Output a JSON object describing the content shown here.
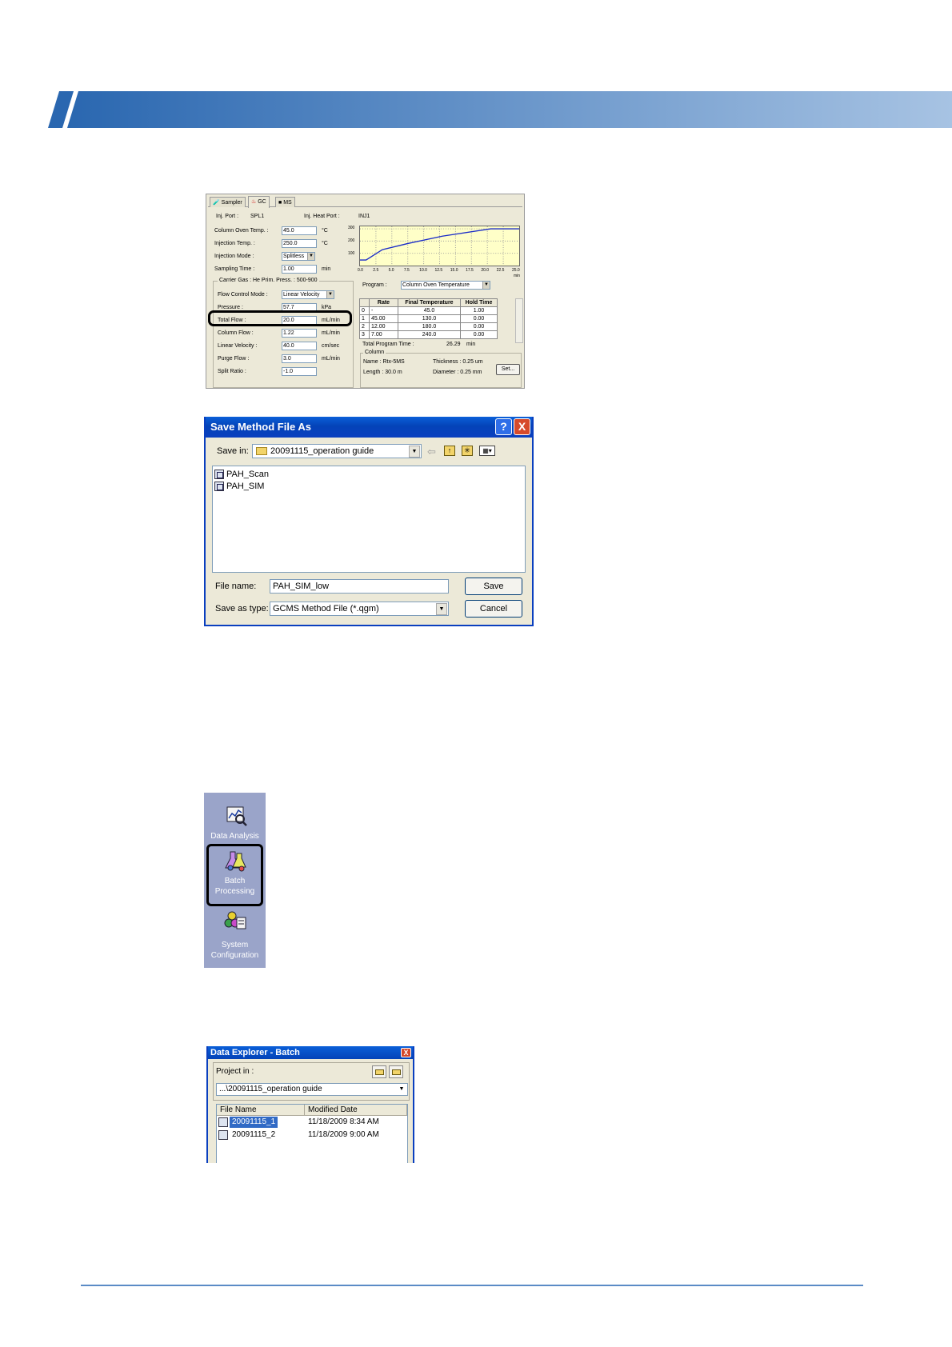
{
  "colors": {
    "banner_dark": "#2a67b0",
    "banner_light": "#a7c3e3",
    "xp_title": "#0a3fbf",
    "sidebar_bg": "#9aa4c9",
    "footer_line": "#5b8bc6"
  },
  "gc_panel": {
    "tabs": [
      {
        "label": "Sampler",
        "icon": "sampler-icon"
      },
      {
        "label": "GC",
        "icon": "gc-icon"
      },
      {
        "label": "MS",
        "icon": "ms-icon"
      }
    ],
    "inj_port_label": "Inj. Port :",
    "inj_port_value": "SPL1",
    "inj_heat_port_label": "Inj. Heat Port :",
    "inj_heat_port_value": "INJ1",
    "column_oven_temp": {
      "label": "Column Oven Temp. :",
      "value": "45.0",
      "unit": "°C"
    },
    "injection_temp": {
      "label": "Injection Temp. :",
      "value": "250.0",
      "unit": "°C"
    },
    "injection_mode": {
      "label": "Injection Mode :",
      "value": "Splitless"
    },
    "sampling_time": {
      "label": "Sampling Time :",
      "value": "1.00",
      "unit": "min"
    },
    "carrier_gas": "Carrier Gas : He    Prim. Press. : 500-900",
    "flow_control_mode": {
      "label": "Flow Control Mode :",
      "value": "Linear Velocity"
    },
    "pressure": {
      "label": "Pressure :",
      "value": "57.7",
      "unit": "kPa"
    },
    "total_flow": {
      "label": "Total Flow :",
      "value": "20.0",
      "unit": "mL/min"
    },
    "column_flow": {
      "label": "Column Flow :",
      "value": "1.22",
      "unit": "mL/min"
    },
    "linear_velocity": {
      "label": "Linear Velocity :",
      "value": "40.0",
      "unit": "cm/sec"
    },
    "purge_flow": {
      "label": "Purge Flow :",
      "value": "3.0",
      "unit": "mL/min"
    },
    "split_ratio": {
      "label": "Split Ratio :",
      "value": "-1.0"
    },
    "chart_x_ticks": [
      "0.0",
      "2.5",
      "5.0",
      "7.5",
      "10.0",
      "12.5",
      "15.0",
      "17.5",
      "20.0",
      "22.5",
      "25.0"
    ],
    "chart_x_unit": "min",
    "chart_y_ticks": [
      "300",
      "200",
      "100"
    ],
    "chart_profile": [
      [
        0,
        45
      ],
      [
        1,
        45
      ],
      [
        3.7,
        130
      ],
      [
        3.7,
        130
      ],
      [
        7.9,
        180
      ],
      [
        13.6,
        240
      ],
      [
        21.6,
        300
      ],
      [
        26.3,
        300
      ]
    ],
    "program_label": "Program :",
    "program_value": "Column Oven Temperature",
    "table_headers": [
      "",
      "Rate",
      "Final Temperature",
      "Hold Time"
    ],
    "table_rows": [
      [
        "0",
        "-",
        "45.0",
        "1.00"
      ],
      [
        "1",
        "45.00",
        "130.0",
        "0.00"
      ],
      [
        "2",
        "12.00",
        "180.0",
        "0.00"
      ],
      [
        "3",
        "7.00",
        "240.0",
        "0.00"
      ]
    ],
    "total_program_time_label": "Total Program Time :",
    "total_program_time_value": "26.29",
    "total_program_time_unit": "min",
    "column_group": "Column",
    "column_name": "Name : Rtx-5MS",
    "column_length": "Length : 30.0 m",
    "column_thickness": "Thickness : 0.25 um",
    "column_diameter": "Diameter : 0.25 mm",
    "set_button": "Set..."
  },
  "save_dialog": {
    "title": "Save Method File As",
    "save_in_label": "Save in:",
    "save_in_value": "20091115_operation guide",
    "files": [
      "PAH_Scan",
      "PAH_SIM"
    ],
    "file_name_label": "File name:",
    "file_name_value": "PAH_SIM_low",
    "save_type_label": "Save as type:",
    "save_type_value": "GCMS Method File (*.qgm)",
    "save_button": "Save",
    "cancel_button": "Cancel",
    "help_button": "?",
    "close_button": "X"
  },
  "sidebar": {
    "items": [
      {
        "label_1": "Data Analysis",
        "label_2": "",
        "icon": "data-analysis-icon"
      },
      {
        "label_1": "Batch",
        "label_2": "Processing",
        "icon": "batch-processing-icon",
        "selected": true
      },
      {
        "label_1": "System",
        "label_2": "Configuration",
        "icon": "system-configuration-icon"
      }
    ]
  },
  "data_explorer": {
    "title": "Data Explorer - Batch",
    "project_in_label": "Project in :",
    "project_path": "...\\20091115_operation guide",
    "headers": [
      "File Name",
      "Modified Date"
    ],
    "rows": [
      [
        "20091115_1",
        "11/18/2009 8:34 AM"
      ],
      [
        "20091115_2",
        "11/18/2009 9:00 AM"
      ]
    ],
    "close_button": "X"
  }
}
